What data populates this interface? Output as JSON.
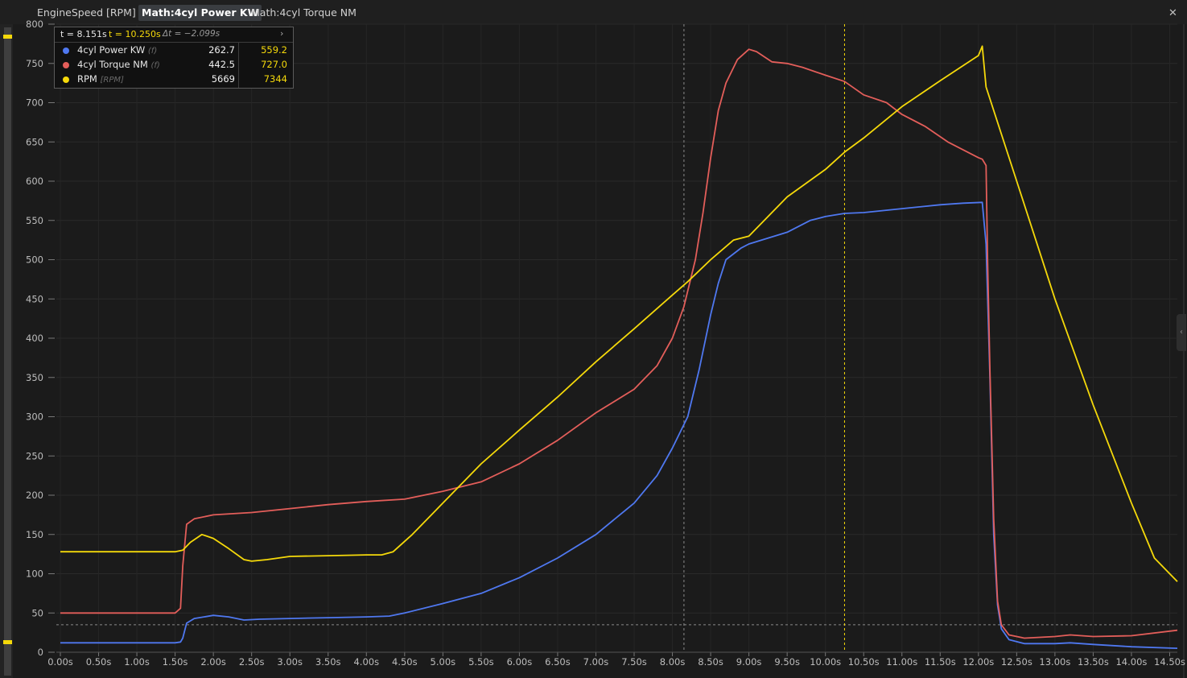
{
  "tabs": [
    {
      "label": "EngineSpeed [RPM]",
      "active": false
    },
    {
      "label": "Math:4cyl Power KW",
      "active": true
    },
    {
      "label": "Math:4cyl Torque NM",
      "active": false
    }
  ],
  "close_icon": "close-icon",
  "legend": {
    "cursor1": "t = 8.151s",
    "cursor2": "t = 10.250s",
    "delta": "Δt = −2.099s",
    "expand_icon": "chevron-right-icon",
    "rows": [
      {
        "name": "4cyl Power KW",
        "unit": "(f)",
        "color": "#4f78f0",
        "v1": "262.7",
        "v2": "559.2"
      },
      {
        "name": "4cyl Torque NM",
        "unit": "(f)",
        "color": "#e35e5a",
        "v1": "442.5",
        "v2": "727.0"
      },
      {
        "name": "RPM",
        "unit": "[RPM]",
        "color": "#f5d90a",
        "v1": "5669",
        "v2": "7344"
      }
    ]
  },
  "chart_data": {
    "type": "line",
    "title": "",
    "xlabel": "",
    "ylabel": "",
    "xlim": [
      0,
      14.6
    ],
    "ylim": [
      0,
      800
    ],
    "x_ticks": [
      0,
      0.5,
      1,
      1.5,
      2,
      2.5,
      3,
      3.5,
      4,
      4.5,
      5,
      5.5,
      6,
      6.5,
      7,
      7.5,
      8,
      8.5,
      9,
      9.5,
      10,
      10.5,
      11,
      11.5,
      12,
      12.5,
      13,
      13.5,
      14,
      14.5
    ],
    "x_tick_labels": [
      "0.00s",
      "0.50s",
      "1.00s",
      "1.50s",
      "2.00s",
      "2.50s",
      "3.00s",
      "3.50s",
      "4.00s",
      "4.50s",
      "5.00s",
      "5.50s",
      "6.00s",
      "6.50s",
      "7.00s",
      "7.50s",
      "8.00s",
      "8.50s",
      "9.00s",
      "9.50s",
      "10.00s",
      "10.50s",
      "11.00s",
      "11.50s",
      "12.00s",
      "12.50s",
      "13.00s",
      "13.50s",
      "14.00s",
      "14.50s"
    ],
    "y_ticks": [
      0,
      50,
      100,
      150,
      200,
      250,
      300,
      350,
      400,
      450,
      500,
      550,
      600,
      650,
      700,
      750,
      800
    ],
    "y_tick_labels": [
      "0",
      "50",
      "100",
      "150",
      "200",
      "250",
      "300",
      "350",
      "400",
      "450",
      "500",
      "550",
      "600",
      "650",
      "700",
      "750",
      "800"
    ],
    "grid": true,
    "cursors": [
      {
        "t": 8.151,
        "color": "#8a8a8a"
      },
      {
        "t": 10.25,
        "color": "#f5d90a"
      }
    ],
    "reference_line_y": 35,
    "series": [
      {
        "name": "4cyl Power KW",
        "color": "#4f78f0",
        "points": [
          [
            0,
            12
          ],
          [
            1,
            12
          ],
          [
            1.5,
            12
          ],
          [
            1.57,
            13
          ],
          [
            1.6,
            18
          ],
          [
            1.65,
            37
          ],
          [
            1.75,
            43
          ],
          [
            2,
            47
          ],
          [
            2.2,
            45
          ],
          [
            2.4,
            41
          ],
          [
            2.6,
            42
          ],
          [
            3,
            43
          ],
          [
            3.5,
            44
          ],
          [
            4,
            45
          ],
          [
            4.3,
            46
          ],
          [
            4.5,
            50
          ],
          [
            5,
            62
          ],
          [
            5.5,
            75
          ],
          [
            6,
            95
          ],
          [
            6.5,
            120
          ],
          [
            7,
            150
          ],
          [
            7.5,
            190
          ],
          [
            7.8,
            225
          ],
          [
            8,
            260
          ],
          [
            8.2,
            300
          ],
          [
            8.35,
            360
          ],
          [
            8.5,
            430
          ],
          [
            8.6,
            470
          ],
          [
            8.7,
            500
          ],
          [
            8.9,
            515
          ],
          [
            9,
            520
          ],
          [
            9.5,
            535
          ],
          [
            9.8,
            550
          ],
          [
            10,
            555
          ],
          [
            10.25,
            559
          ],
          [
            10.5,
            560
          ],
          [
            11,
            565
          ],
          [
            11.5,
            570
          ],
          [
            11.8,
            572
          ],
          [
            12.05,
            573
          ],
          [
            12.1,
            520
          ],
          [
            12.15,
            350
          ],
          [
            12.2,
            150
          ],
          [
            12.25,
            60
          ],
          [
            12.3,
            30
          ],
          [
            12.4,
            16
          ],
          [
            12.6,
            11
          ],
          [
            13,
            11
          ],
          [
            13.2,
            12
          ],
          [
            13.5,
            10
          ],
          [
            14,
            7
          ],
          [
            14.6,
            5
          ]
        ]
      },
      {
        "name": "4cyl Torque NM",
        "color": "#e35e5a",
        "points": [
          [
            0,
            50
          ],
          [
            1,
            50
          ],
          [
            1.5,
            50
          ],
          [
            1.57,
            56
          ],
          [
            1.6,
            110
          ],
          [
            1.65,
            163
          ],
          [
            1.75,
            170
          ],
          [
            2,
            175
          ],
          [
            2.5,
            178
          ],
          [
            3,
            183
          ],
          [
            3.5,
            188
          ],
          [
            4,
            192
          ],
          [
            4.5,
            195
          ],
          [
            5,
            205
          ],
          [
            5.5,
            217
          ],
          [
            6,
            240
          ],
          [
            6.5,
            270
          ],
          [
            7,
            305
          ],
          [
            7.5,
            335
          ],
          [
            7.8,
            365
          ],
          [
            8,
            400
          ],
          [
            8.15,
            440
          ],
          [
            8.3,
            500
          ],
          [
            8.4,
            560
          ],
          [
            8.5,
            630
          ],
          [
            8.6,
            690
          ],
          [
            8.7,
            725
          ],
          [
            8.85,
            755
          ],
          [
            9,
            768
          ],
          [
            9.1,
            765
          ],
          [
            9.3,
            752
          ],
          [
            9.5,
            750
          ],
          [
            9.7,
            745
          ],
          [
            10,
            735
          ],
          [
            10.25,
            727
          ],
          [
            10.5,
            710
          ],
          [
            10.8,
            700
          ],
          [
            11,
            685
          ],
          [
            11.3,
            670
          ],
          [
            11.6,
            650
          ],
          [
            12,
            630
          ],
          [
            12.05,
            628
          ],
          [
            12.1,
            620
          ],
          [
            12.12,
            500
          ],
          [
            12.15,
            360
          ],
          [
            12.2,
            170
          ],
          [
            12.25,
            65
          ],
          [
            12.3,
            35
          ],
          [
            12.4,
            22
          ],
          [
            12.6,
            18
          ],
          [
            13,
            20
          ],
          [
            13.2,
            22
          ],
          [
            13.5,
            20
          ],
          [
            14,
            21
          ],
          [
            14.6,
            28
          ]
        ]
      },
      {
        "name": "RPM",
        "unit": "RPM",
        "color": "#f5d90a",
        "points": [
          [
            0,
            128
          ],
          [
            1,
            128
          ],
          [
            1.5,
            128
          ],
          [
            1.6,
            130
          ],
          [
            1.7,
            140
          ],
          [
            1.85,
            150
          ],
          [
            2,
            145
          ],
          [
            2.2,
            132
          ],
          [
            2.4,
            118
          ],
          [
            2.5,
            116
          ],
          [
            2.7,
            118
          ],
          [
            3,
            122
          ],
          [
            3.5,
            123
          ],
          [
            4,
            124
          ],
          [
            4.2,
            124
          ],
          [
            4.35,
            128
          ],
          [
            4.6,
            150
          ],
          [
            5,
            190
          ],
          [
            5.5,
            240
          ],
          [
            6,
            283
          ],
          [
            6.5,
            325
          ],
          [
            7,
            370
          ],
          [
            7.5,
            412
          ],
          [
            8,
            455
          ],
          [
            8.2,
            472
          ],
          [
            8.5,
            500
          ],
          [
            8.8,
            525
          ],
          [
            9,
            530
          ],
          [
            9.5,
            580
          ],
          [
            10,
            615
          ],
          [
            10.25,
            637
          ],
          [
            10.5,
            655
          ],
          [
            11,
            695
          ],
          [
            11.5,
            728
          ],
          [
            12,
            760
          ],
          [
            12.05,
            772
          ],
          [
            12.1,
            720
          ],
          [
            12.5,
            600
          ],
          [
            13,
            450
          ],
          [
            13.5,
            315
          ],
          [
            14,
            190
          ],
          [
            14.3,
            120
          ],
          [
            14.6,
            90
          ]
        ]
      }
    ]
  }
}
